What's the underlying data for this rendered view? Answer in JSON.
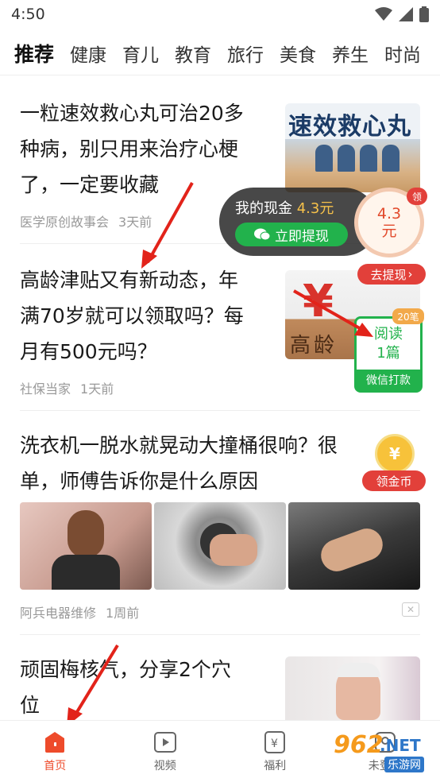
{
  "status_bar": {
    "time": "4:50"
  },
  "tabs": [
    "推荐",
    "健康",
    "育儿",
    "教育",
    "旅行",
    "美食",
    "养生",
    "时尚"
  ],
  "feed": [
    {
      "title_lines": [
        "一粒速效救心丸可治20多",
        "种病，别只用来治疗心梗",
        "了，一定要收藏"
      ],
      "source": "医学原创故事会",
      "time": "3天前",
      "thumb_text": "速效救心丸"
    },
    {
      "title_lines": [
        "高龄津贴又有新动态，年",
        "满70岁就可以领取吗？每",
        "月有500元吗？"
      ],
      "source": "社保当家",
      "time": "1天前",
      "thumb_text": "高龄"
    },
    {
      "title_lines": [
        "洗衣机一脱水就晃动大撞桶很响？很",
        "单，师傅告诉你是什么原因"
      ],
      "source": "阿兵电器维修",
      "time": "1周前",
      "close_label": "✕"
    },
    {
      "title_lines": [
        "顽固梅核气，分享2个穴",
        "位"
      ]
    }
  ],
  "cash_widget": {
    "label": "我的现金",
    "amount": "4.3元",
    "button": "立即提现",
    "circle_amount": "4.3",
    "circle_unit": "元",
    "corner": "领"
  },
  "withdraw_badge": "去提现",
  "read_card": {
    "count_badge": "20笔",
    "line1": "阅读",
    "line2": "1篇",
    "footer": "微信打款"
  },
  "coin_badge": {
    "symbol": "¥",
    "label": "领金币"
  },
  "bottom_nav": [
    {
      "label": "首页",
      "active": true
    },
    {
      "label": "视频",
      "active": false
    },
    {
      "label": "福利",
      "active": false
    },
    {
      "label": "未登录",
      "active": false
    }
  ],
  "watermark": {
    "brand": "962",
    "suffix": ".NET",
    "sub": "乐游网"
  },
  "colors": {
    "accent": "#ee4b2b",
    "green": "#22b24c",
    "gold": "#f6c14a"
  }
}
